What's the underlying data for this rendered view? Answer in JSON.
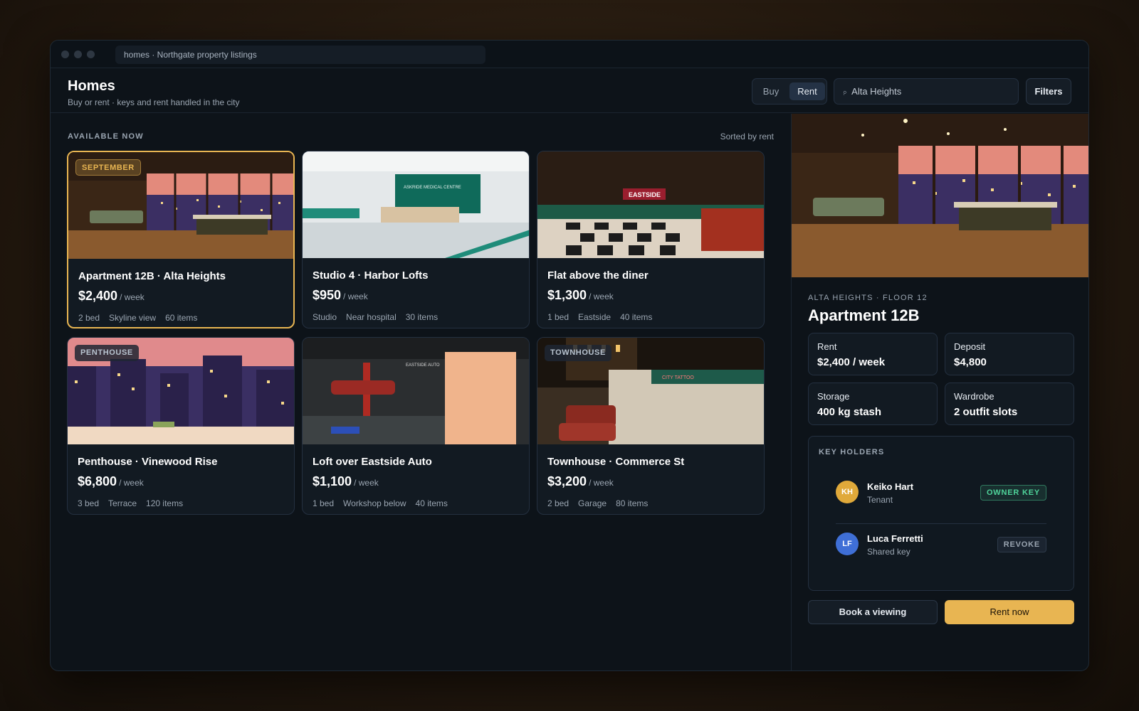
{
  "window": {
    "url": "homes · Northgate property listings"
  },
  "header": {
    "title": "Homes",
    "subtitle": "Buy or rent · keys and rent handled in the city",
    "mode_buy": "Buy",
    "mode_rent": "Rent",
    "active_mode": "Rent",
    "search_value": "Alta Heights",
    "filters_label": "Filters"
  },
  "listings": {
    "section_label": "AVAILABLE NOW",
    "sort_label": "Sorted by rent",
    "cards": [
      {
        "badge": "SEPTEMBER",
        "name": "Apartment 12B · Alta Heights",
        "price": "$2,400",
        "per": "/ week",
        "meta": [
          "2 bed",
          "Skyline view",
          "60 items"
        ],
        "selected": true
      },
      {
        "badge": "",
        "name": "Studio 4 · Harbor Lofts",
        "price": "$950",
        "per": "/ week",
        "meta": [
          "Studio",
          "Near hospital",
          "30 items"
        ]
      },
      {
        "badge": "",
        "name": "Flat above the diner",
        "price": "$1,300",
        "per": "/ week",
        "meta": [
          "1 bed",
          "Eastside",
          "40 items"
        ]
      },
      {
        "badge": "PENTHOUSE",
        "name": "Penthouse · Vinewood Rise",
        "price": "$6,800",
        "per": "/ week",
        "meta": [
          "3 bed",
          "Terrace",
          "120 items"
        ]
      },
      {
        "badge": "",
        "name": "Loft over Eastside Auto",
        "price": "$1,100",
        "per": "/ week",
        "meta": [
          "1 bed",
          "Workshop below",
          "40 items"
        ]
      },
      {
        "badge": "TOWNHOUSE",
        "name": "Townhouse · Commerce St",
        "price": "$3,200",
        "per": "/ week",
        "meta": [
          "2 bed",
          "Garage",
          "80 items"
        ]
      }
    ],
    "image_signs": {
      "clinic": "ASKRIDE MEDICAL CENTRE",
      "diner": "EASTSIDE",
      "garage": "EASTSIDE AUTO",
      "street": "CITY TATTOO"
    }
  },
  "detail": {
    "location": "ALTA HEIGHTS · FLOOR 12",
    "title": "Apartment 12B",
    "stats": [
      {
        "label": "Rent",
        "value": "$2,400 / week"
      },
      {
        "label": "Deposit",
        "value": "$4,800"
      },
      {
        "label": "Storage",
        "value": "400 kg stash"
      },
      {
        "label": "Wardrobe",
        "value": "2 outfit slots"
      }
    ],
    "key_holders_label": "KEY HOLDERS",
    "holders": [
      {
        "initials": "KH",
        "name": "Keiko Hart",
        "role": "Tenant",
        "tag": "OWNER KEY",
        "avatar_color": "#e0a93a"
      },
      {
        "initials": "LF",
        "name": "Luca Ferretti",
        "role": "Shared key",
        "tag": "REVOKE",
        "avatar_color": "#3f6fd6"
      }
    ],
    "book_label": "Book a viewing",
    "rent_label": "Rent now"
  },
  "colors": {
    "accent": "#e8b552",
    "owner_tag": "#4fd39a",
    "background": "#0d1319"
  }
}
